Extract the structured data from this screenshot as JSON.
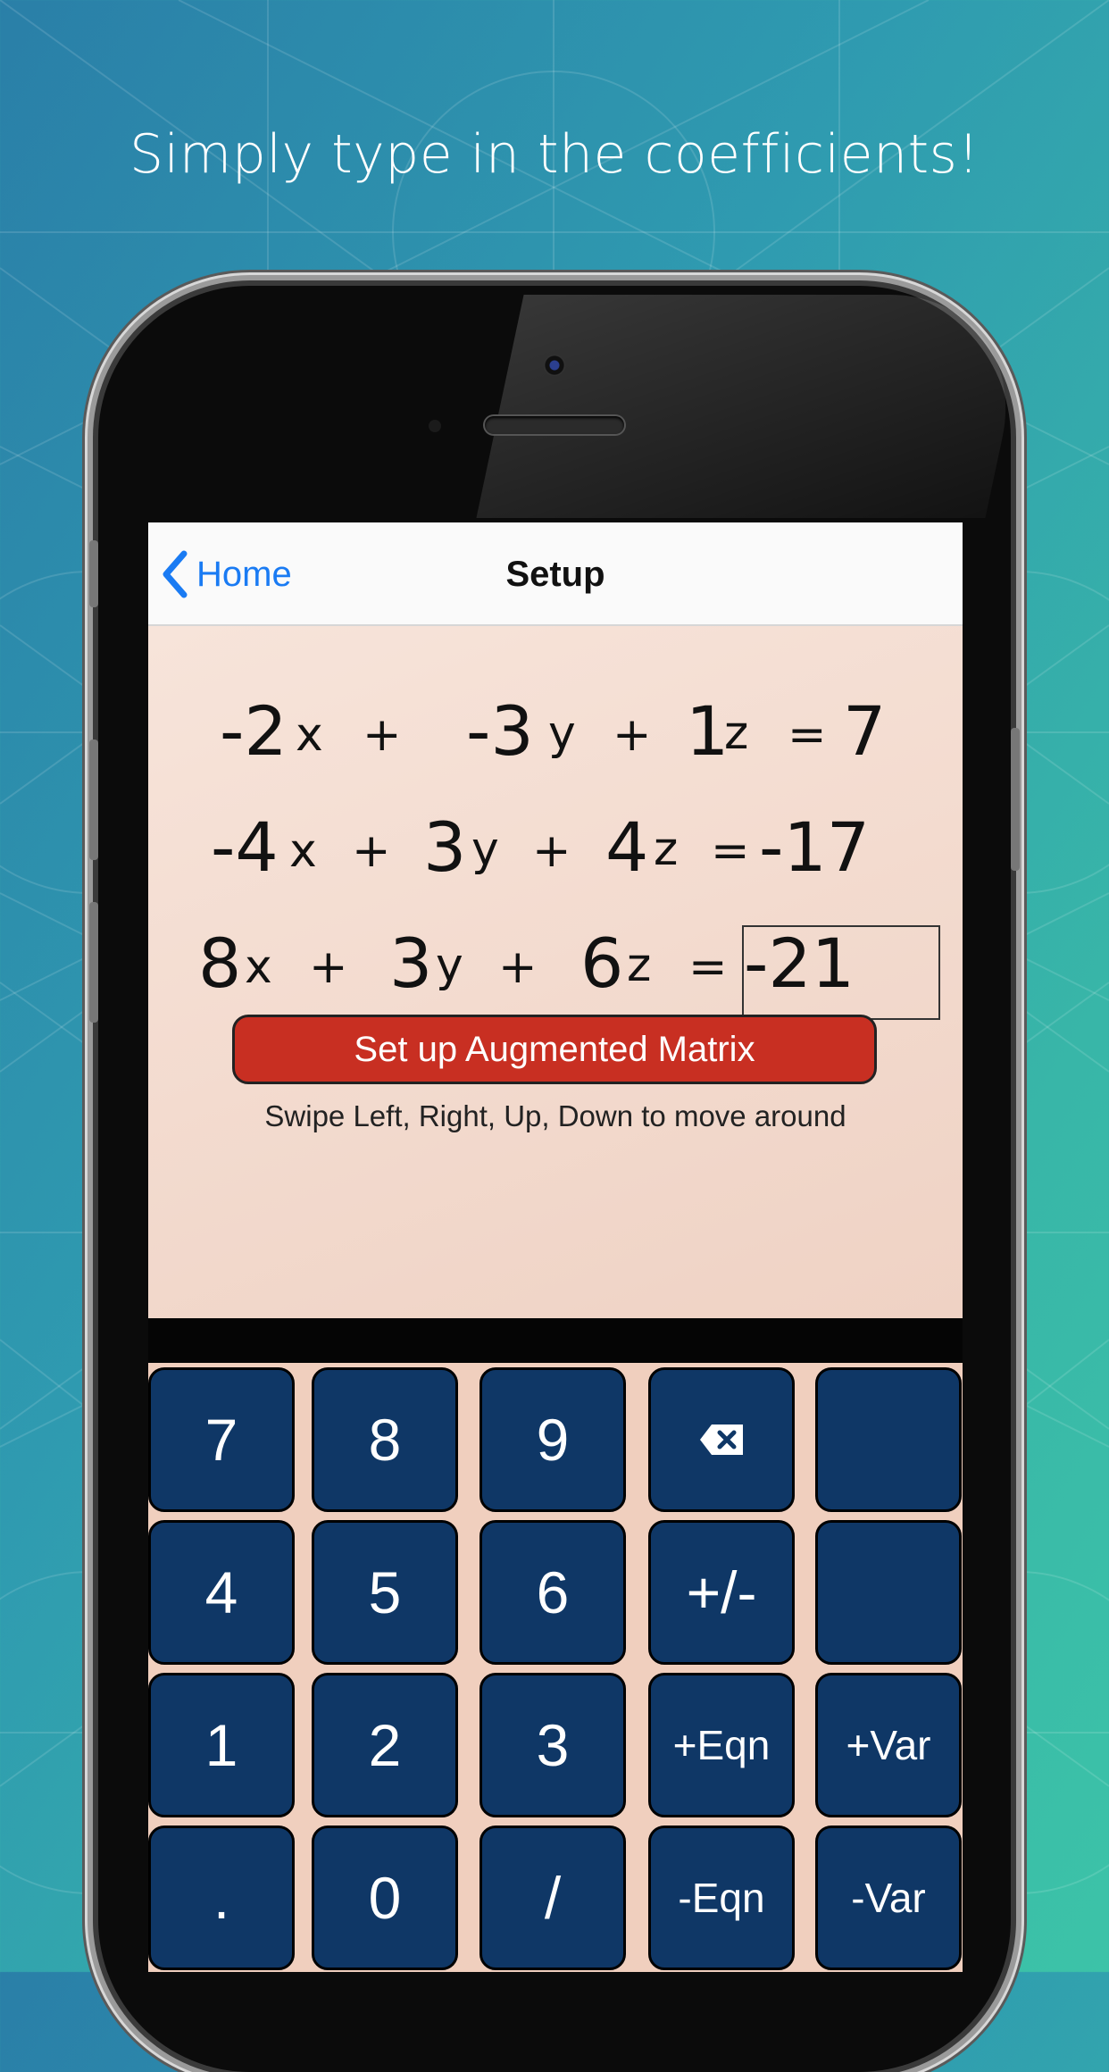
{
  "tagline": "Simply type in the coefficients!",
  "nav": {
    "back_label": "Home",
    "title": "Setup"
  },
  "equations": [
    {
      "x": "-2",
      "y": "-3",
      "z": "1",
      "rhs": "7"
    },
    {
      "x": "-4",
      "y": "3",
      "z": "4",
      "rhs": "-17"
    },
    {
      "x": "8",
      "y": "3",
      "z": "6",
      "rhs": "-21"
    }
  ],
  "vars": {
    "x": "x",
    "y": "y",
    "z": "z",
    "plus": "+",
    "equals": "="
  },
  "setup_button": "Set up Augmented Matrix",
  "hint": "Swipe Left, Right, Up, Down to move around",
  "keys": {
    "k7": "7",
    "k8": "8",
    "k9": "9",
    "k4": "4",
    "k5": "5",
    "k6": "6",
    "plusminus": "+/-",
    "k1": "1",
    "k2": "2",
    "k3": "3",
    "add_eqn": "+Eqn",
    "add_var": "+Var",
    "dot": ".",
    "k0": "0",
    "slash": "/",
    "del_eqn": "-Eqn",
    "del_var": "-Var"
  },
  "colors": {
    "key_bg": "#0f3766",
    "button_red": "#c82f22",
    "link_blue": "#1a7bf3"
  }
}
